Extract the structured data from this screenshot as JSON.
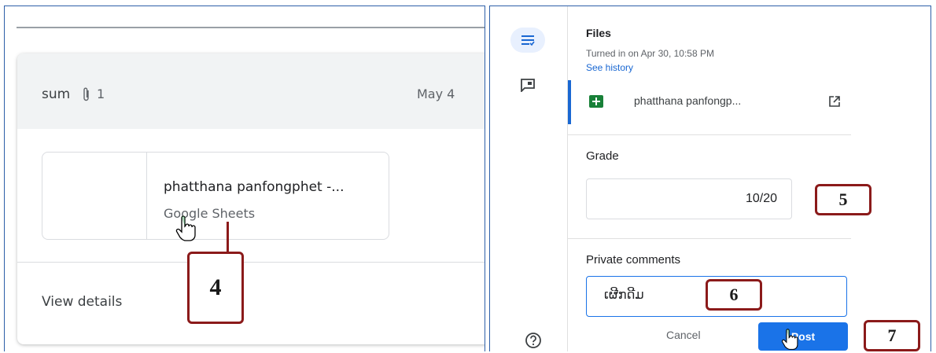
{
  "left": {
    "assignment_title": "sum",
    "attachment_count": "1",
    "due_date": "May 4",
    "attachment": {
      "name": "phatthana panfongphet -...",
      "type": "Google Sheets"
    },
    "view_details": "View details"
  },
  "right": {
    "files_label": "Files",
    "turned_in": "Turned in on Apr 30, 10:58 PM",
    "see_history": "See history",
    "file_name": "phatthana panfongp...",
    "grade_label": "Grade",
    "grade_value": "10/20",
    "private_comments_label": "Private comments",
    "comment_text": "ເຜີກດີມ",
    "cancel_label": "Cancel",
    "post_label": "Post"
  },
  "callouts": [
    "4",
    "5",
    "6",
    "7"
  ],
  "colors": {
    "callout_border": "#8b1a1a",
    "panel_border": "#2d5fa8",
    "accent_blue": "#1a73e8",
    "sheets_green": "#188038"
  }
}
